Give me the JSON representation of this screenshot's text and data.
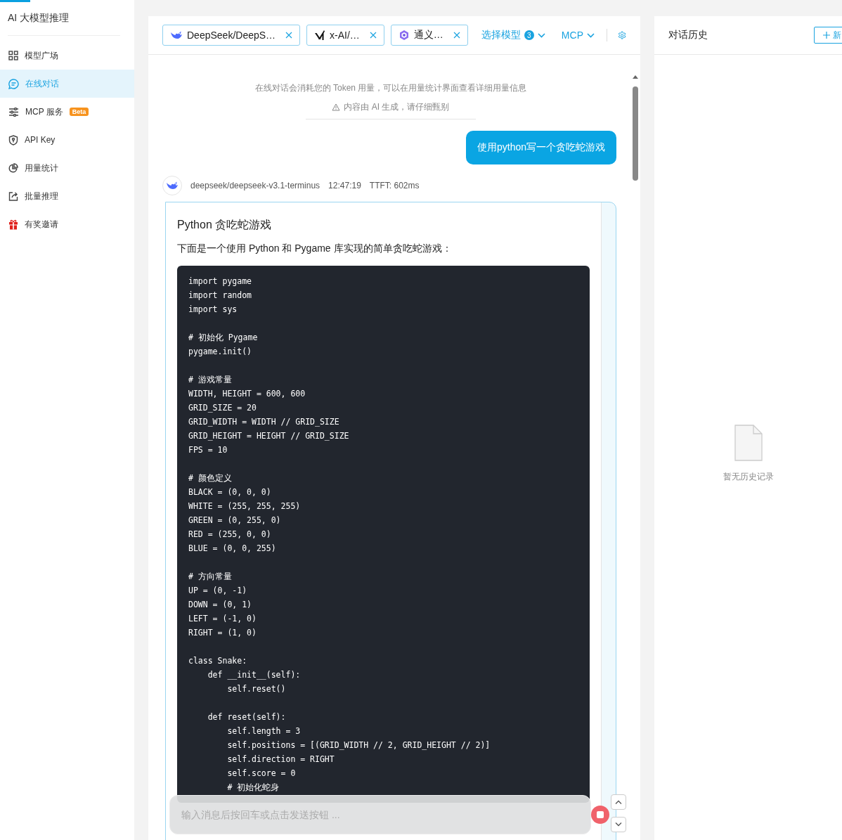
{
  "sidebar": {
    "title": "AI 大模型推理",
    "items": [
      {
        "label": "模型广场",
        "kind": "grid",
        "selected": false
      },
      {
        "label": "在线对话",
        "kind": "chat",
        "selected": true
      },
      {
        "label": "MCP 服务",
        "kind": "sliders",
        "badge": "Beta",
        "selected": false
      },
      {
        "label": "API Key",
        "kind": "shield",
        "selected": false
      },
      {
        "label": "用量统计",
        "kind": "pie",
        "selected": false
      },
      {
        "label": "批量推理",
        "kind": "export",
        "selected": false
      },
      {
        "label": "有奖邀请",
        "kind": "gift",
        "selected": false
      }
    ]
  },
  "chat": {
    "model_tabs": [
      {
        "name": "DeepSeek/DeepS…",
        "kind": "whale"
      },
      {
        "name": "x-AI/…",
        "kind": "slash"
      },
      {
        "name": "通义…",
        "kind": "hexagon"
      }
    ],
    "select_model": {
      "label": "选择模型",
      "count": "3"
    },
    "mcp": "MCP",
    "notice": "在线对话会消耗您的 Token 用量，可以在用量统计界面查看详细用量信息",
    "disclaimer": "内容由 AI 生成，请仔细甄别",
    "user_message": "使用python写一个贪吃蛇游戏",
    "reply": {
      "model": "deepseek/deepseek-v3.1-terminus",
      "time": "12:47:19",
      "ttft": "TTFT: 602ms",
      "title": "Python 贪吃蛇游戏",
      "intro": "下面是一个使用 Python 和 Pygame 库实现的简单贪吃蛇游戏：",
      "code_blocks": [
        [
          "import pygame",
          "import random",
          "import sys"
        ],
        [
          "# 初始化 Pygame",
          "pygame.init()"
        ],
        [
          "# 游戏常量",
          "WIDTH, HEIGHT = 600, 600",
          "GRID_SIZE = 20",
          "GRID_WIDTH = WIDTH // GRID_SIZE",
          "GRID_HEIGHT = HEIGHT // GRID_SIZE",
          "FPS = 10"
        ],
        [
          "# 颜色定义",
          "BLACK = (0, 0, 0)",
          "WHITE = (255, 255, 255)",
          "GREEN = (0, 255, 0)",
          "RED = (255, 0, 0)",
          "BLUE = (0, 0, 255)"
        ],
        [
          "# 方向常量",
          "UP = (0, -1)",
          "DOWN = (0, 1)",
          "LEFT = (-1, 0)",
          "RIGHT = (1, 0)"
        ],
        [
          "class Snake:",
          "    def __init__(self):",
          "        self.reset()"
        ],
        [
          "    def reset(self):",
          "        self.length = 3",
          "        self.positions = [(GRID_WIDTH // 2, GRID_HEIGHT // 2)]",
          "        self.direction = RIGHT",
          "        self.score = 0",
          "        # 初始化蛇身"
        ]
      ]
    },
    "input": {
      "placeholder": "输入消息后按回车或点击发送按钮 ..."
    }
  },
  "history": {
    "title": "对话历史",
    "new_button": "新",
    "empty": "暂无历史记录"
  }
}
